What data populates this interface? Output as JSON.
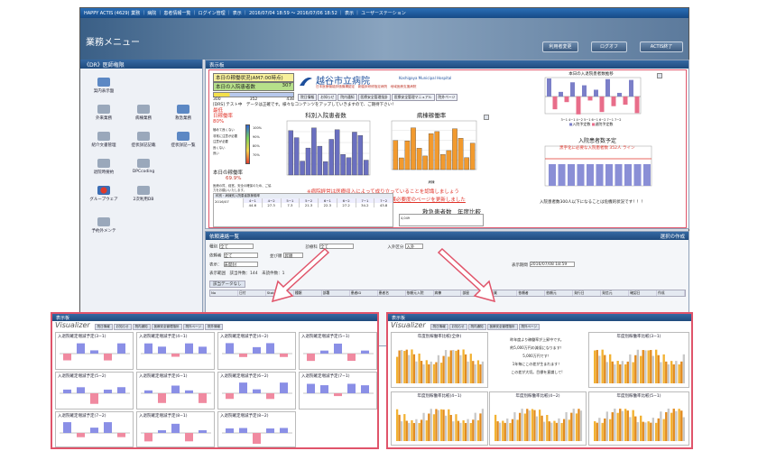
{
  "window": {
    "titlebar": "HAPPY ACTIS (4629) 業務 ｜ 病院 ｜ 患者情報一覧 ｜ ログイン管理 ｜ 表示 ｜ 2016/07/04 18:59 ～ 2016/07/06 18:52 ｜ 表示 ｜ ユーザーステーション",
    "app_title": "業務メニュー",
    "buttons": {
      "password": "利用者変更",
      "logout": "ログオフ",
      "exit": "ACTIS終了"
    }
  },
  "sidebar": {
    "header": "《DR》医師権限",
    "items": [
      {
        "label": "案内表示盤",
        "icon": "monitor-icon"
      },
      {
        "label": "外来業務",
        "icon": "outpatient-icon"
      },
      {
        "label": "病棟業務",
        "icon": "bed-icon"
      },
      {
        "label": "救急業務",
        "icon": "ambulance-bed-icon"
      },
      {
        "label": "紹介文書管理",
        "icon": "document-icon"
      },
      {
        "label": "症状詳記記載",
        "icon": "edit-icon"
      },
      {
        "label": "症状詳記一覧",
        "icon": "edit-list-icon"
      },
      {
        "label": "退院時要約",
        "icon": "summary-icon"
      },
      {
        "label": "DPCcoding",
        "icon": "coding-icon"
      },
      {
        "label": "グループウェア",
        "icon": "groupware-icon"
      },
      {
        "label": "2次利用DB",
        "icon": "database-icon"
      },
      {
        "label": "予約外メンテ",
        "icon": "monitor-icon"
      }
    ],
    "footer": "《DR》システム管理者権"
  },
  "dashboard": {
    "header": "表示板",
    "hospital_name": "越谷市立病院",
    "hospital_name_en": "Koshigaya Municipal Hospital",
    "hospital_subtitle": "日本医療機能評価機構認定　新臨床研修指定病院　地域医療支援病院",
    "nav": [
      "院日情報",
      "お知らせ",
      "院内通知",
      "医療安全管理指針",
      "医療安全管理マニュアル",
      "院外ページ"
    ],
    "today_status_title": "本日の稼働状況(AM7:00時点)",
    "admissions_label": "本日の入院患者数",
    "admissions_value": "307",
    "gauge_ticks": [
      "300",
      "352",
      "438"
    ],
    "ticker_prefix": "[DRS]",
    "ticker": "テスト中　データは正確です。様々なコンテンツをアップしていきますので、ご期待下さい！",
    "gauge_title": "最低\n日稼働率\n80%",
    "gauge_levels": [
      "極めて良くない",
      "非常に注意が必要",
      "注意が必要",
      "良くない",
      "良い"
    ],
    "gauge_pcts": [
      "100%",
      "90%",
      "80%",
      "70%"
    ],
    "gauge_label": "本日の稼働率",
    "gauge_value": "69.9%",
    "notice_small": "医療の質、経営、安全の確保のため、ご協力をお願いいたします。",
    "chart1_title": "科別入院患者数",
    "chart2_title": "病棟稼働率",
    "chart2_legend": "病棟",
    "chart3_title": "本日の入退院患者数推移",
    "chart3_legend": [
      "入院予定数",
      "退院予定数"
    ],
    "chart3_xlabels": "3−1 4−1 4−2 5−1 6−1 6−2 7−1 7−2",
    "chart4_title": "入院患者数予定",
    "chart4_note": "黒字化に必要な入院患者数 352人 ライン",
    "warning_red": "※病院経営は医療収入によって成り立っていることを認識しましょう",
    "warning_link": "看護必要度のページを更新しました",
    "emergency_title": "救急患者数　年度比較",
    "right_note": "入院患者数300人以下になることは危機的状況です！！！",
    "table_left_header": "科別・病棟別入院患者数稼働率",
    "table_row_label": "2016/07",
    "table_cols": [
      "4−1",
      "4−2",
      "5−1",
      "5−2",
      "6−1",
      "6−2",
      "7−1",
      "7−2"
    ],
    "table_vals": [
      "44.6",
      "27.3",
      "7.3",
      "21.3",
      "22.3",
      "27.2",
      "34.2",
      "43.8"
    ],
    "emergency_value": "4,049"
  },
  "list": {
    "header": "依頼連絡一覧",
    "header_right": "選択の作成",
    "filters": {
      "type_label": "種別",
      "type_value": "全て",
      "dept_label": "診療科",
      "dept_value": "全て",
      "input_label": "入外区分",
      "input_value": "入外",
      "author_label": "依頼者",
      "author_value": "全て",
      "order_label": "並び順",
      "order_value": "昇順",
      "show_label": "表示：",
      "show_value": "未開封",
      "date_label": "表示期間",
      "date_value": "2016/07/08 18:59"
    },
    "summary": "表示範囲　該当件数：144　未読件数：1",
    "tab": "該当データなし",
    "columns": [
      "No",
      "日付",
      "Stat",
      "種類",
      "部署",
      "患者ID",
      "患者名",
      "依頼元入院",
      "病棟",
      "部屋",
      "作業",
      "依頼者",
      "依頼元",
      "発行日",
      "発信元",
      "確認日",
      "作成"
    ]
  },
  "zoom_left": {
    "header": "表示板",
    "visualizer": "Visualizer",
    "tabs": [
      "院日情報",
      "お知らせ",
      "院内通知",
      "医療安全管理指針",
      "院外ページ",
      "院外情報"
    ],
    "charts": [
      "入退院確定増減予定(3−1)",
      "入退院確定増減予定(4−1)",
      "入退院確定増減予定(4−2)",
      "入退院確定増減予定(5−1)",
      "入退院確定増減予定(5−2)",
      "入退院確定増減予定(6−1)",
      "入退院確定増減予定(6−2)",
      "入退院確定増減予定(7−1)",
      "入退院確定増減予定(7−2)",
      "入退院確定増減予定(8−1)",
      "入退院確定増減予定(8−2)"
    ]
  },
  "zoom_right": {
    "header": "表示板",
    "visualizer": "Visualizer",
    "tabs": [
      "院日情報",
      "お知らせ",
      "院内通知",
      "医療安全管理指針",
      "院外ページ"
    ],
    "charts": [
      "年度別稼働率比較(全体)",
      "年度別稼働率比較(3−1)",
      "年度別稼働率比較(4−1)",
      "年度別稼働率比較(4−2)",
      "年度別稼働率比較(5−1)"
    ],
    "center_text": [
      "昨年度より稼働率が上昇中です。",
      "約5,000万円の減収になります！",
      "5,000万円です！",
      "1年毎にこの差が生まれます！",
      "この差が大切。目標を意識して!"
    ]
  },
  "colors": {
    "accent": "#e0546a",
    "bar": "#7b7fc8",
    "bar_orange": "#f29a2e",
    "header": "#1f4a7d"
  }
}
